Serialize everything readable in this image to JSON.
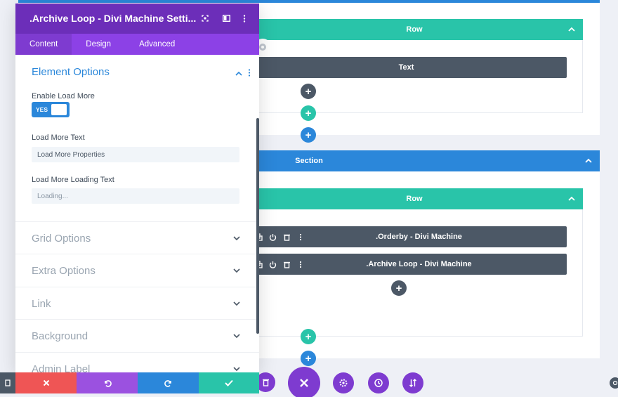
{
  "panel": {
    "title": ".Archive Loop - Divi Machine Setti...",
    "tabs": [
      "Content",
      "Design",
      "Advanced"
    ],
    "open_group": {
      "title": "Element Options",
      "fields": {
        "enable_load_more_label": "Enable Load More",
        "toggle_value": "YES",
        "load_more_text_label": "Load More Text",
        "load_more_text_value": "Load More Properties",
        "load_more_loading_text_label": "Load More Loading Text",
        "load_more_loading_text_placeholder": "Loading..."
      }
    },
    "closed_groups": [
      "Grid Options",
      "Extra Options",
      "Link",
      "Background",
      "Admin Label"
    ]
  },
  "canvas": {
    "row1_label": "Row",
    "text_module_label": "Text",
    "section_label": "Section",
    "row2_label": "Row",
    "modules": [
      ".Orderby - Divi Machine",
      ".Archive Loop - Divi Machine"
    ]
  },
  "colors": {
    "purple_header": "#6c2eb9",
    "purple_tabs": "#8c41e6",
    "teal": "#29c4a9",
    "blue": "#2b87da",
    "dark": "#4c5866",
    "red": "#ef5555"
  }
}
